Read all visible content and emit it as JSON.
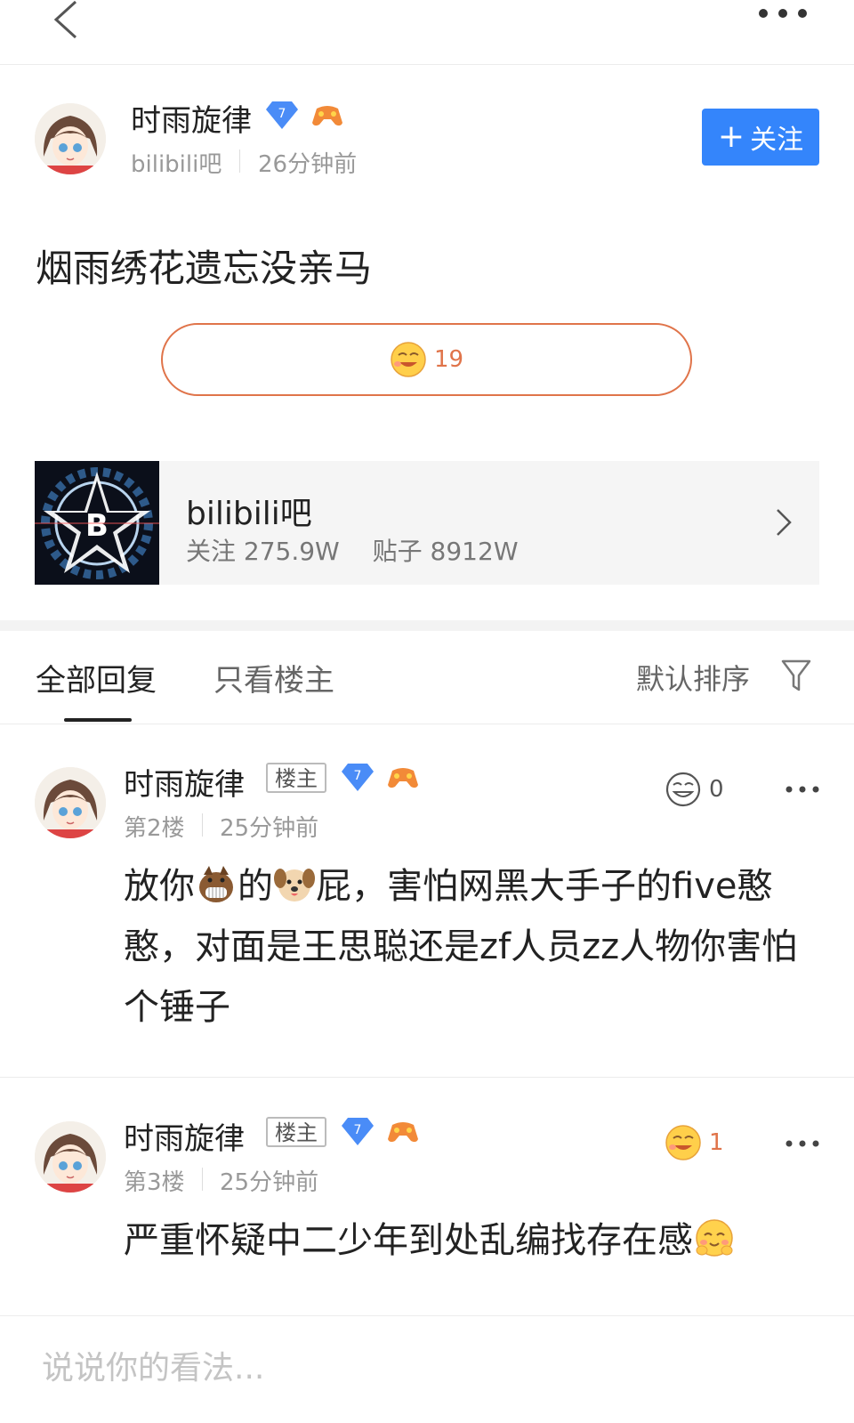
{
  "topbar": {
    "back_icon": "chevron-left-icon",
    "more_icon": "more-dots-icon"
  },
  "post": {
    "author": {
      "name": "时雨旋律",
      "level": "7",
      "forum": "bilibili吧",
      "time": "26分钟前"
    },
    "follow_button": {
      "plus": "+",
      "label": "关注"
    },
    "text": "烟雨绣花遗忘没亲马",
    "reaction": {
      "icon": "laugh-emoji-icon",
      "count": "19"
    }
  },
  "forum_card": {
    "name": "bilibili吧",
    "followers": "关注 275.9W",
    "posts": "贴子 8912W"
  },
  "tabs": {
    "all_replies": "全部回复",
    "owner_only": "只看楼主",
    "sort": "默认排序"
  },
  "replies": [
    {
      "author": "时雨旋律",
      "badge": "楼主",
      "level": "7",
      "floor": "第2楼",
      "time": "25分钟前",
      "like_count": "0",
      "text_segments": [
        "放你",
        "的",
        "屁，害怕网黑大手子的five憨憨，对面是王思聪还是zf人员zz人物你害怕个锤子"
      ]
    },
    {
      "author": "时雨旋律",
      "badge": "楼主",
      "level": "7",
      "floor": "第3楼",
      "time": "25分钟前",
      "like_count": "1",
      "text_segments": [
        "严重怀疑中二少年到处乱编找存在感"
      ]
    }
  ],
  "comment_bar": {
    "placeholder": "说说你的看法..."
  },
  "colors": {
    "accent": "#3485fb",
    "reaction": "#e0744a",
    "level_badge": "#4a8cf7"
  }
}
